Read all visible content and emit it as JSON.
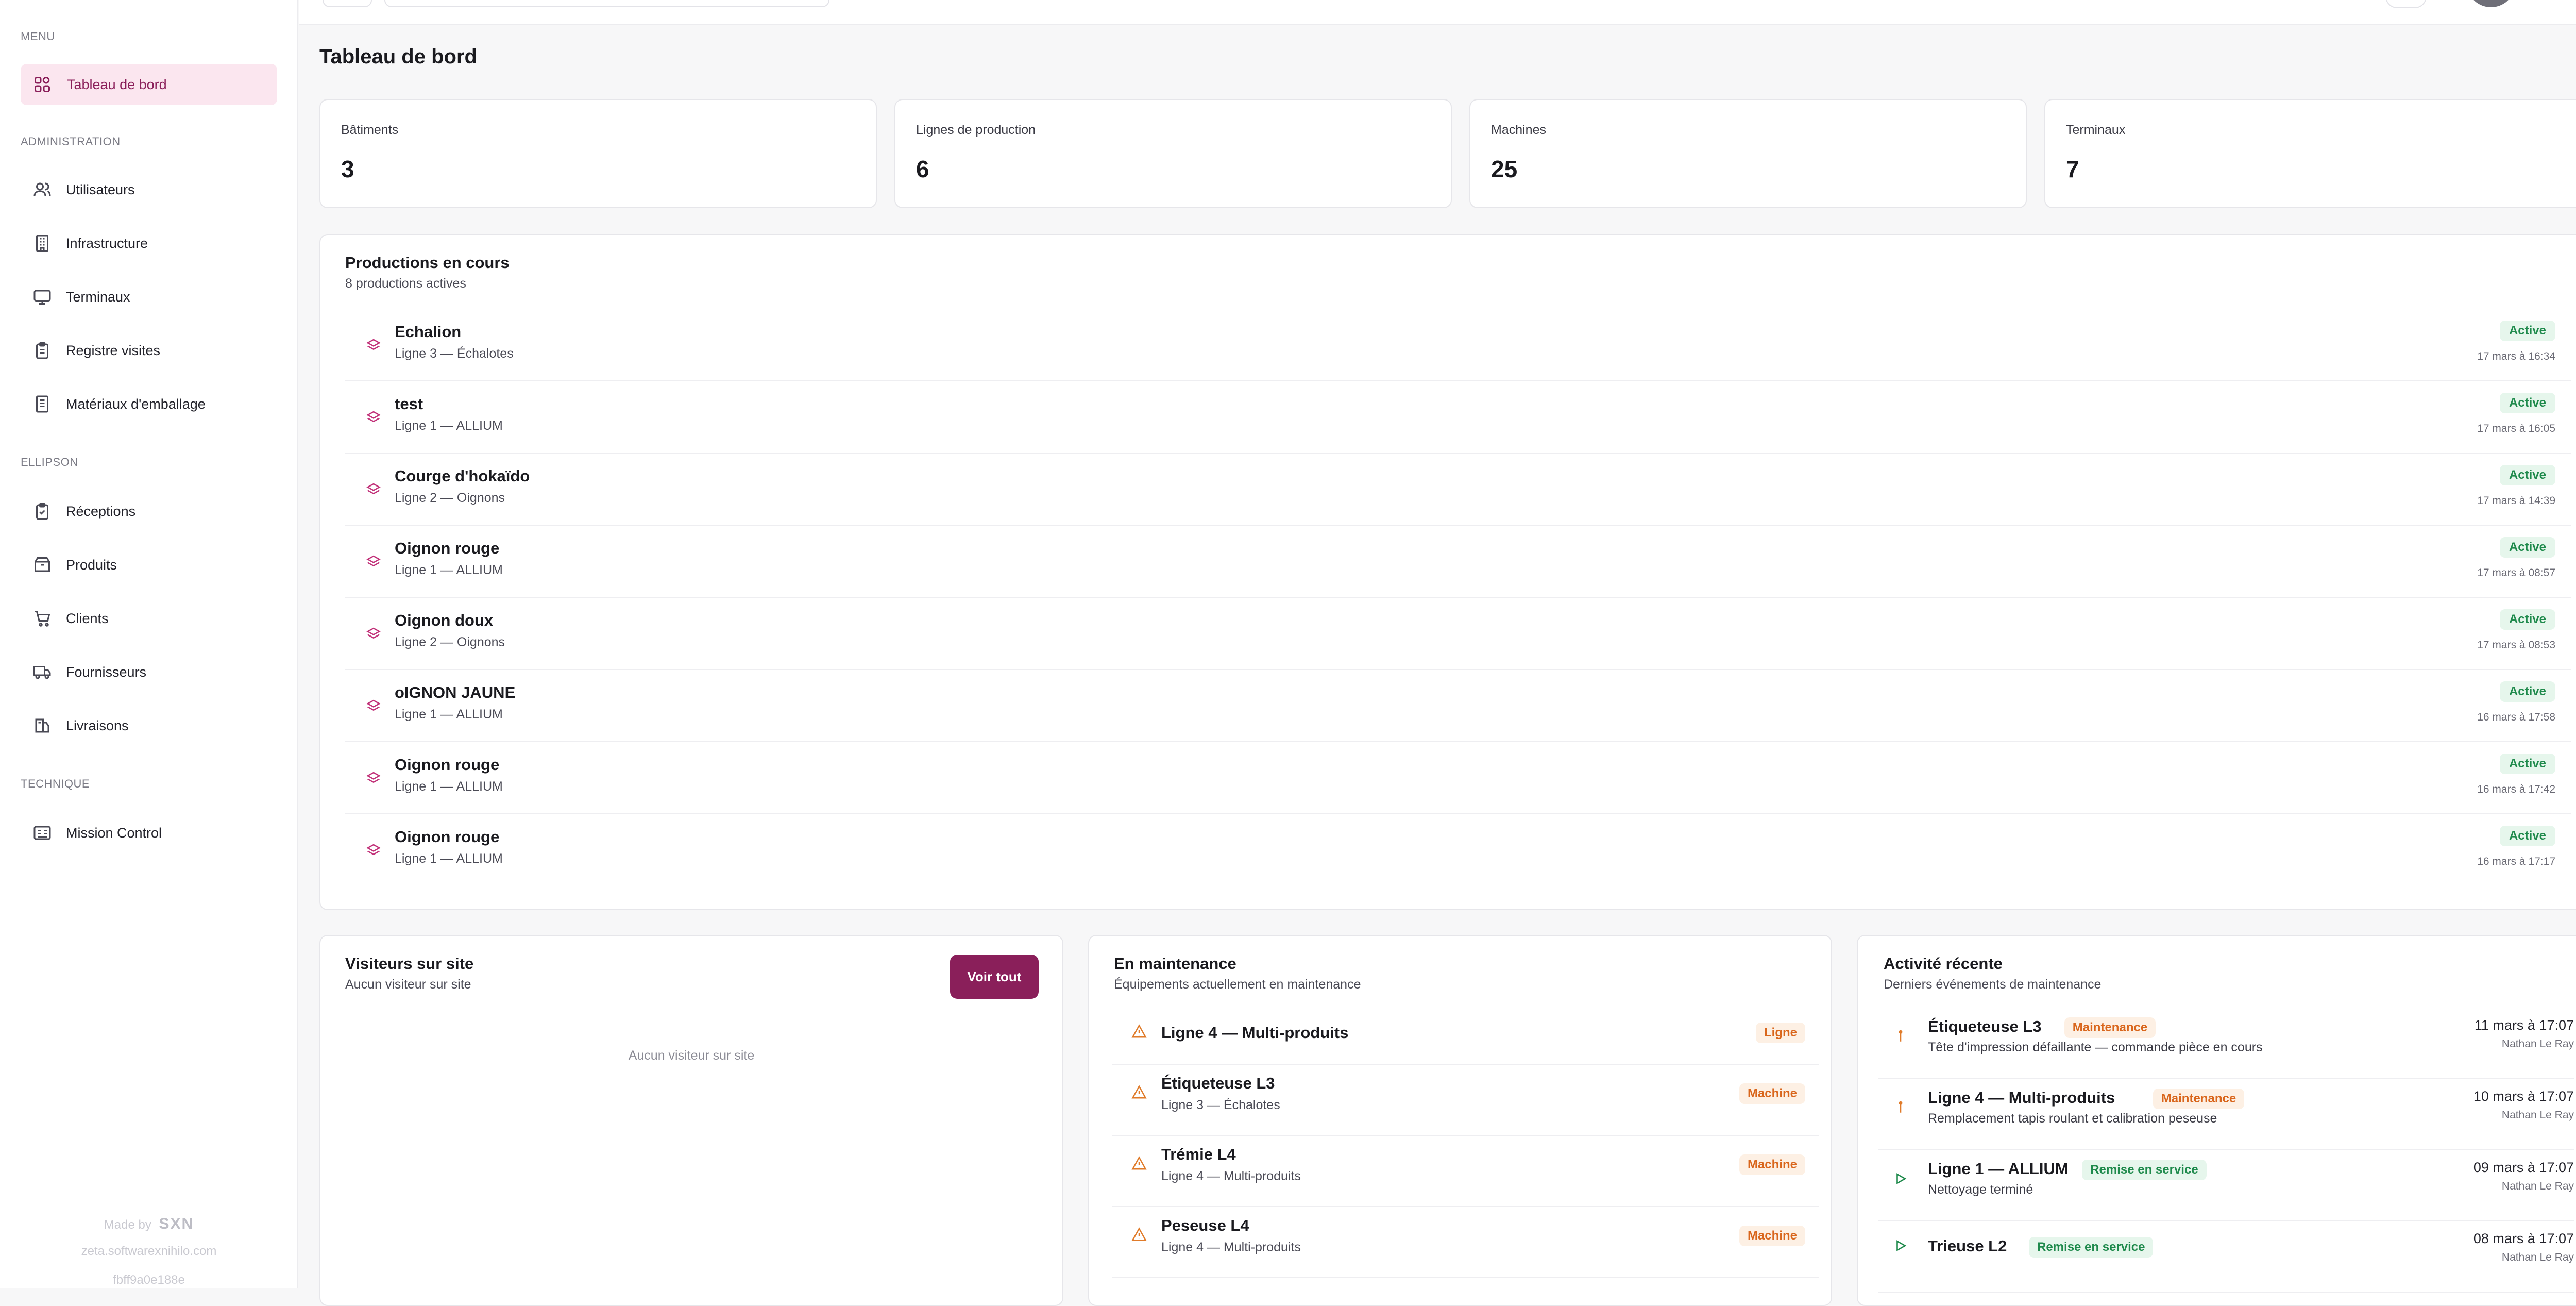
{
  "sidebar": {
    "sections": {
      "menu": "MENU",
      "administration": "ADMINISTRATION",
      "ellipson": "ELLIPSON",
      "technique": "TECHNIQUE"
    },
    "items": {
      "dashboard": "Tableau de bord",
      "users": "Utilisateurs",
      "infrastructure": "Infrastructure",
      "terminals": "Terminaux",
      "visits": "Registre visites",
      "packaging": "Matériaux d'emballage",
      "receptions": "Réceptions",
      "products": "Produits",
      "clients": "Clients",
      "suppliers": "Fournisseurs",
      "deliveries": "Livraisons",
      "mission_control": "Mission Control"
    },
    "footer": {
      "made_by": "Made by",
      "logo_text": "SXN",
      "domain": "zeta.softwarexnihilo.com",
      "build": "fbff9a0e188e"
    }
  },
  "page": {
    "title": "Tableau de bord"
  },
  "stats": [
    {
      "label": "Bâtiments",
      "value": "3"
    },
    {
      "label": "Lignes de production",
      "value": "6"
    },
    {
      "label": "Machines",
      "value": "25"
    },
    {
      "label": "Terminaux",
      "value": "7"
    }
  ],
  "productions": {
    "title": "Productions en cours",
    "subtitle": "8 productions actives",
    "status_label": "Active",
    "rows": [
      {
        "name": "Echalion",
        "line": "Ligne 3 — Échalotes",
        "date": "17 mars à 16:34"
      },
      {
        "name": "test",
        "line": "Ligne 1 — ALLIUM",
        "date": "17 mars à 16:05"
      },
      {
        "name": "Courge d'hokaïdo",
        "line": "Ligne 2 — Oignons",
        "date": "17 mars à 14:39"
      },
      {
        "name": "Oignon rouge",
        "line": "Ligne 1 — ALLIUM",
        "date": "17 mars à 08:57"
      },
      {
        "name": "Oignon doux",
        "line": "Ligne 2 — Oignons",
        "date": "17 mars à 08:53"
      },
      {
        "name": "oIGNON JAUNE",
        "line": "Ligne 1 — ALLIUM",
        "date": "16 mars à 17:58"
      },
      {
        "name": "Oignon rouge",
        "line": "Ligne 1 — ALLIUM",
        "date": "16 mars à 17:42"
      },
      {
        "name": "Oignon rouge",
        "line": "Ligne 1 — ALLIUM",
        "date": "16 mars à 17:17"
      }
    ]
  },
  "visitors": {
    "title": "Visiteurs sur site",
    "subtitle": "Aucun visiteur sur site",
    "button": "Voir tout",
    "empty": "Aucun visiteur sur site"
  },
  "maintenance": {
    "title": "En maintenance",
    "subtitle": "Équipements actuellement en maintenance",
    "rows": [
      {
        "name": "Ligne 4 — Multi-produits",
        "line": "",
        "badge": "Ligne"
      },
      {
        "name": "Étiqueteuse L3",
        "line": "Ligne 3 — Échalotes",
        "badge": "Machine"
      },
      {
        "name": "Trémie L4",
        "line": "Ligne 4 — Multi-produits",
        "badge": "Machine"
      },
      {
        "name": "Peseuse L4",
        "line": "Ligne 4 — Multi-produits",
        "badge": "Machine"
      }
    ]
  },
  "activity": {
    "title": "Activité récente",
    "subtitle": "Derniers événements de maintenance",
    "rows": [
      {
        "name": "Étiqueteuse L3",
        "badge": "Maintenance",
        "kind": "mnt",
        "desc": "Tête d'impression défaillante — commande pièce en cours",
        "date": "11 mars à 17:07",
        "user": "Nathan Le Ray"
      },
      {
        "name": "Ligne 4 — Multi-produits",
        "badge": "Maintenance",
        "kind": "mnt",
        "desc": "Remplacement tapis roulant et calibration peseuse",
        "date": "10 mars à 17:07",
        "user": "Nathan Le Ray"
      },
      {
        "name": "Ligne 1 — ALLIUM",
        "badge": "Remise en service",
        "kind": "svc",
        "desc": "Nettoyage terminé",
        "date": "09 mars à 17:07",
        "user": "Nathan Le Ray"
      },
      {
        "name": "Trieuse L2",
        "badge": "Remise en service",
        "kind": "svc",
        "desc": "",
        "date": "08 mars à 17:07",
        "user": "Nathan Le Ray"
      }
    ]
  }
}
